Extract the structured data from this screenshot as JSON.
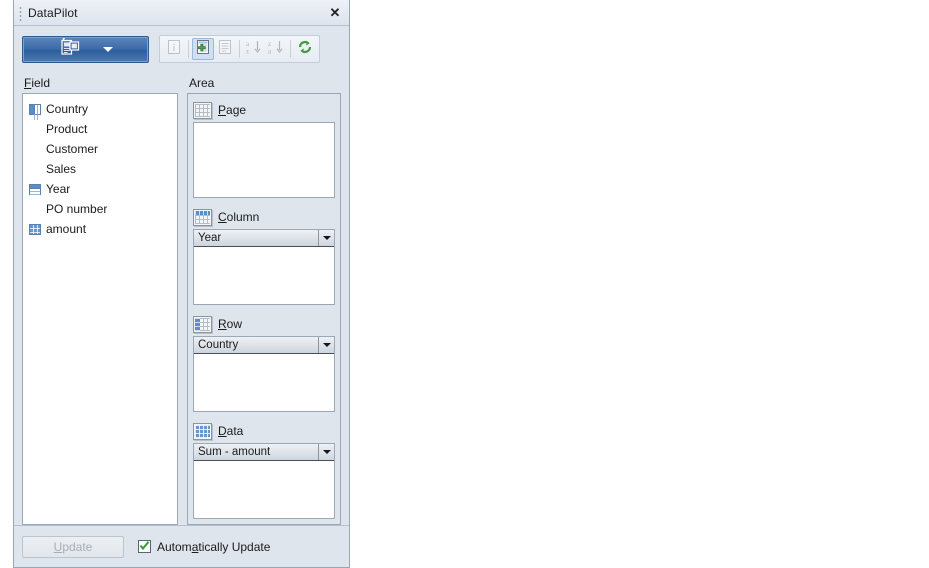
{
  "panel": {
    "title": "DataPilot",
    "close_icon": "close-icon"
  },
  "toolbar": {
    "main_button": {
      "icon": "datapilot-layout-icon",
      "dropdown_icon": "chevron-down-icon"
    },
    "buttons": [
      {
        "name": "field-info-button",
        "icon": "info-icon",
        "enabled": false
      },
      {
        "name": "add-field-button",
        "icon": "add-field-icon",
        "enabled": true
      },
      {
        "name": "remove-field-button",
        "icon": "remove-field-icon",
        "enabled": false
      },
      {
        "name": "sort-ascending-button",
        "icon": "sort-az-icon",
        "enabled": false
      },
      {
        "name": "sort-descending-button",
        "icon": "sort-za-icon",
        "enabled": false
      },
      {
        "name": "refresh-button",
        "icon": "refresh-icon",
        "enabled": true
      }
    ]
  },
  "field_panel": {
    "label_prefix": "F",
    "label_rest": "ield",
    "items": [
      {
        "label": "Country",
        "icon": "field-row-icon",
        "icon_type": "row"
      },
      {
        "label": "Product",
        "icon": "",
        "icon_type": "none"
      },
      {
        "label": "Customer",
        "icon": "",
        "icon_type": "none"
      },
      {
        "label": "Sales",
        "icon": "",
        "icon_type": "none"
      },
      {
        "label": "Year",
        "icon": "field-column-icon",
        "icon_type": "colm"
      },
      {
        "label": "PO number",
        "icon": "",
        "icon_type": "none"
      },
      {
        "label": "amount",
        "icon": "field-data-icon",
        "icon_type": "data"
      }
    ]
  },
  "area_panel": {
    "label": "Area",
    "sections": [
      {
        "name": "page",
        "accel": "P",
        "label_rest": "age",
        "icon": "page-area-icon",
        "icon_style": "plain",
        "fields": []
      },
      {
        "name": "column",
        "accel": "C",
        "label_rest": "olumn",
        "icon": "column-area-icon",
        "icon_style": "band-top",
        "fields": [
          {
            "label": "Year",
            "dropdown_icon": "chevron-down-icon"
          }
        ]
      },
      {
        "name": "row",
        "accel": "R",
        "label_rest": "ow",
        "icon": "row-area-icon",
        "icon_style": "band-left",
        "fields": [
          {
            "label": "Country",
            "dropdown_icon": "chevron-down-icon"
          }
        ]
      },
      {
        "name": "data",
        "accel": "D",
        "label_rest": "ata",
        "icon": "data-area-icon",
        "icon_style": "band-all",
        "fields": [
          {
            "label": "Sum - amount",
            "dropdown_icon": "chevron-down-icon"
          }
        ]
      }
    ]
  },
  "bottom_bar": {
    "update_button": {
      "accel": "U",
      "label_rest": "pdate",
      "enabled": false
    },
    "auto_update": {
      "accel_pre": "Autom",
      "accel": "a",
      "accel_post": "tically Update",
      "checked": true,
      "check_icon": "checkmark-icon"
    }
  },
  "colors": {
    "panel_bg": "#dfe5ec",
    "panel_border": "#9aa7b5",
    "accent_blue": "#3f6da9",
    "field_blue": "#5b8ccc",
    "check_green": "#2e9e3c",
    "disabled_text": "#a7aeb6"
  }
}
